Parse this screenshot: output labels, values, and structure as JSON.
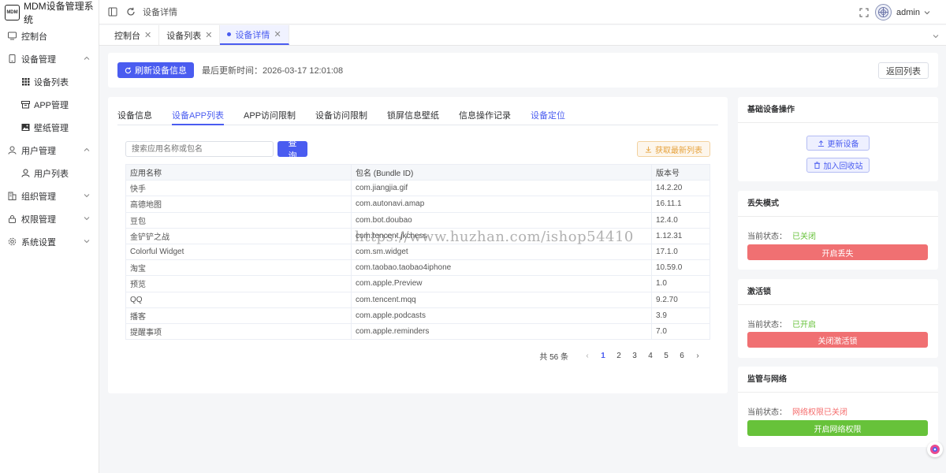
{
  "app": {
    "title": "MDM设备管理系统",
    "logo_text": "MDM"
  },
  "sidebar": {
    "items": [
      {
        "label": "控制台"
      },
      {
        "label": "设备管理"
      },
      {
        "label": "设备列表"
      },
      {
        "label": "APP管理"
      },
      {
        "label": "壁纸管理"
      },
      {
        "label": "用户管理"
      },
      {
        "label": "用户列表"
      },
      {
        "label": "组织管理"
      },
      {
        "label": "权限管理"
      },
      {
        "label": "系统设置"
      }
    ]
  },
  "header": {
    "breadcrumb": "设备详情",
    "username": "admin"
  },
  "tabs": [
    {
      "label": "控制台"
    },
    {
      "label": "设备列表"
    },
    {
      "label": "设备详情"
    }
  ],
  "toolbar": {
    "refresh_label": "刷新设备信息",
    "updated_text": "最后更新时间：2026-03-17 12:01:08",
    "back_label": "返回列表"
  },
  "detail_tabs": [
    {
      "label": "设备信息"
    },
    {
      "label": "设备APP列表"
    },
    {
      "label": "APP访问限制"
    },
    {
      "label": "设备访问限制"
    },
    {
      "label": "锁屏信息壁纸"
    },
    {
      "label": "信息操作记录"
    },
    {
      "label": "设备定位"
    }
  ],
  "search": {
    "placeholder": "搜索应用名称或包名",
    "button_label": "查询",
    "fetch_label": "获取最新列表"
  },
  "table": {
    "headers": [
      "应用名称",
      "包名 (Bundle ID)",
      "版本号"
    ],
    "rows": [
      [
        "快手",
        "com.jiangjia.gif",
        "14.2.20"
      ],
      [
        "高德地图",
        "com.autonavi.amap",
        "16.11.1"
      ],
      [
        "豆包",
        "com.bot.doubao",
        "12.4.0"
      ],
      [
        "金铲铲之战",
        "com.tencent.jkchess",
        "1.12.31"
      ],
      [
        "Colorful Widget",
        "com.sm.widget",
        "17.1.0"
      ],
      [
        "淘宝",
        "com.taobao.taobao4iphone",
        "10.59.0"
      ],
      [
        "预览",
        "com.apple.Preview",
        "1.0"
      ],
      [
        "QQ",
        "com.tencent.mqq",
        "9.2.70"
      ],
      [
        "播客",
        "com.apple.podcasts",
        "3.9"
      ],
      [
        "提醒事项",
        "com.apple.reminders",
        "7.0"
      ]
    ]
  },
  "pagination": {
    "total": "共 56 条",
    "pages": [
      "1",
      "2",
      "3",
      "4",
      "5",
      "6"
    ],
    "current": "1"
  },
  "panels": {
    "basic": {
      "title": "基础设备操作",
      "update_label": "更新设备",
      "recycle_label": "加入回收站"
    },
    "lost": {
      "title": "丢失模式",
      "status_label": "当前状态：",
      "status_value": "已关闭",
      "status_color": "#67c23a",
      "button_label": "开启丢失"
    },
    "activation": {
      "title": "激活锁",
      "status_label": "当前状态：",
      "status_value": "已开启",
      "status_color": "#67c23a",
      "button_label": "关闭激活锁"
    },
    "network": {
      "title": "监管与网络",
      "status_label": "当前状态：",
      "status_value": "网络权限已关闭",
      "status_color": "#f56c6c",
      "button_label": "开启网络权限"
    }
  },
  "watermark": "https://www.huzhan.com/ishop54410",
  "colors": {
    "primary": "#4a5cf0",
    "danger": "#f07072",
    "success": "#67c23a",
    "warning": "#e6a23c"
  }
}
